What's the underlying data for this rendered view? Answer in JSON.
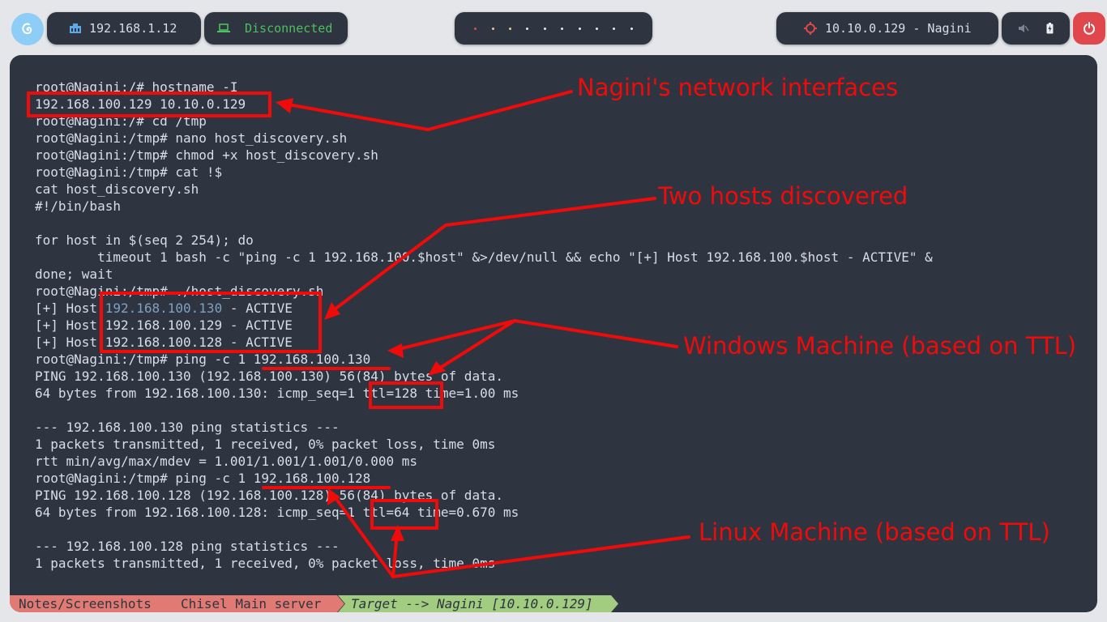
{
  "topbar": {
    "ip_address": "192.168.1.12",
    "vpn_status": "Disconnected",
    "target": "10.10.0.129 - Nagini",
    "workspace_dot_colors": [
      "#e0474c",
      "#ebcb8b",
      "#ebcb8b",
      "#e5e9f0",
      "#e5e9f0",
      "#e5e9f0",
      "#e5e9f0",
      "#e5e9f0",
      "#e5e9f0",
      "#e5e9f0"
    ],
    "icons": {
      "logo": "debian-swirl-icon",
      "ip": "network-icon",
      "vpn": "laptop-icon",
      "target": "crosshair-icon",
      "volume": "speaker-muted-icon",
      "battery": "battery-icon",
      "power": "power-icon"
    }
  },
  "terminal": {
    "lines": [
      "root@Nagini:/# hostname -I",
      "192.168.100.129 10.10.0.129",
      "root@Nagini:/# cd /tmp",
      "root@Nagini:/tmp# nano host_discovery.sh",
      "root@Nagini:/tmp# chmod +x host_discovery.sh",
      "root@Nagini:/tmp# cat !$",
      "cat host_discovery.sh",
      "#!/bin/bash",
      "",
      "for host in $(seq 2 254); do",
      "        timeout 1 bash -c \"ping -c 1 192.168.100.$host\" &>/dev/null && echo \"[+] Host 192.168.100.$host - ACTIVE\" &",
      "done; wait",
      "root@Nagini:/tmp# ./host_discovery.sh",
      "[+] Host 192.168.100.130 - ACTIVE",
      "[+] Host 192.168.100.129 - ACTIVE",
      "[+] Host 192.168.100.128 - ACTIVE",
      "root@Nagini:/tmp# ping -c 1 192.168.100.130",
      "PING 192.168.100.130 (192.168.100.130) 56(84) bytes of data.",
      "64 bytes from 192.168.100.130: icmp_seq=1 ttl=128 time=1.00 ms",
      "",
      "--- 192.168.100.130 ping statistics ---",
      "1 packets transmitted, 1 received, 0% packet loss, time 0ms",
      "rtt min/avg/max/mdev = 1.001/1.001/1.001/0.000 ms",
      "root@Nagini:/tmp# ping -c 1 192.168.100.128",
      "PING 192.168.100.128 (192.168.100.128) 56(84) bytes of data.",
      "64 bytes from 192.168.100.128: icmp_seq=1 ttl=64 time=0.670 ms",
      "",
      "--- 192.168.100.128 ping statistics ---",
      "1 packets transmitted, 1 received, 0% packet loss, time 0ms"
    ],
    "highlighted_text": "192.168.100.130"
  },
  "statusbar": {
    "segments": [
      "Notes/Screenshots",
      "Chisel Main server",
      "Target --> Nagini [10.10.0.129]"
    ],
    "colors": {
      "inactive": "#e27a74",
      "active": "#a2cc7f"
    }
  },
  "annotations": {
    "color": "#f00b0b",
    "network_interfaces": "Nagini's network interfaces",
    "two_hosts": "Two hosts discovered",
    "windows_machine": "Windows Machine (based on TTL)",
    "linux_machine": "Linux Machine (based on TTL)"
  }
}
